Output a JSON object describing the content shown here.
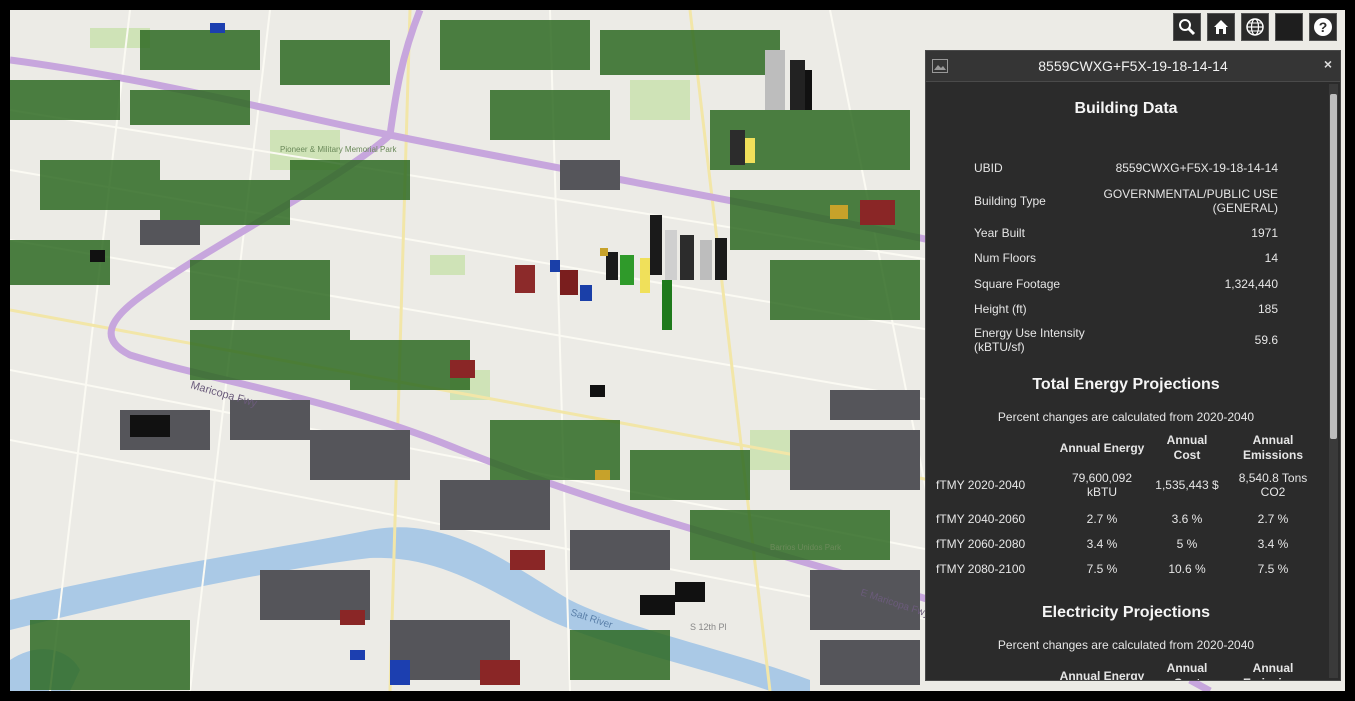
{
  "toolbar": {
    "buttons": [
      {
        "icon": "search-icon"
      },
      {
        "icon": "home-icon"
      },
      {
        "icon": "globe-icon"
      },
      {
        "icon": "basemap-icon"
      },
      {
        "icon": "help-icon",
        "label": "?"
      }
    ]
  },
  "map": {
    "labels": {
      "road": "Maricopa Fwy",
      "river": "Salt River",
      "street": "S 12th Pl",
      "park": "Barrios Unidos Park",
      "cemetery": "Pioneer & Military Memorial Park",
      "street2": "E Maricopa Fwy"
    }
  },
  "panel": {
    "title": "8559CWXG+F5X-19-18-14-14",
    "close": "×",
    "building": {
      "heading": "Building Data",
      "rows": [
        {
          "k": "UBID",
          "v": "8559CWXG+F5X-19-18-14-14"
        },
        {
          "k": "Building Type",
          "v": "GOVERNMENTAL/PUBLIC USE (GENERAL)"
        },
        {
          "k": "Year Built",
          "v": "1971"
        },
        {
          "k": "Num Floors",
          "v": "14"
        },
        {
          "k": "Square Footage",
          "v": "1,324,440"
        },
        {
          "k": "Height (ft)",
          "v": "185"
        },
        {
          "k": "Energy Use Intensity (kBTU/sf)",
          "v": "59.6"
        }
      ]
    },
    "total": {
      "heading": "Total Energy Projections",
      "note": "Percent changes are calculated from 2020-2040",
      "headers": [
        "Annual Energy",
        "Annual Cost",
        "Annual Emissions"
      ],
      "rows": [
        {
          "label": "fTMY 2020-2040",
          "energy": "79,600,092 kBTU",
          "cost": "1,535,443 $",
          "emissions": "8,540.8 Tons CO2"
        },
        {
          "label": "fTMY 2040-2060",
          "energy": "2.7 %",
          "cost": "3.6 %",
          "emissions": "2.7 %"
        },
        {
          "label": "fTMY 2060-2080",
          "energy": "3.4 %",
          "cost": "5 %",
          "emissions": "3.4 %"
        },
        {
          "label": "fTMY 2080-2100",
          "energy": "7.5 %",
          "cost": "10.6 %",
          "emissions": "7.5 %"
        }
      ]
    },
    "electricity": {
      "heading": "Electricity Projections",
      "note": "Percent changes are calculated from 2020-2040",
      "headers": [
        "Annual Energy",
        "Annual Cost",
        "Annual Emissions"
      ]
    }
  }
}
